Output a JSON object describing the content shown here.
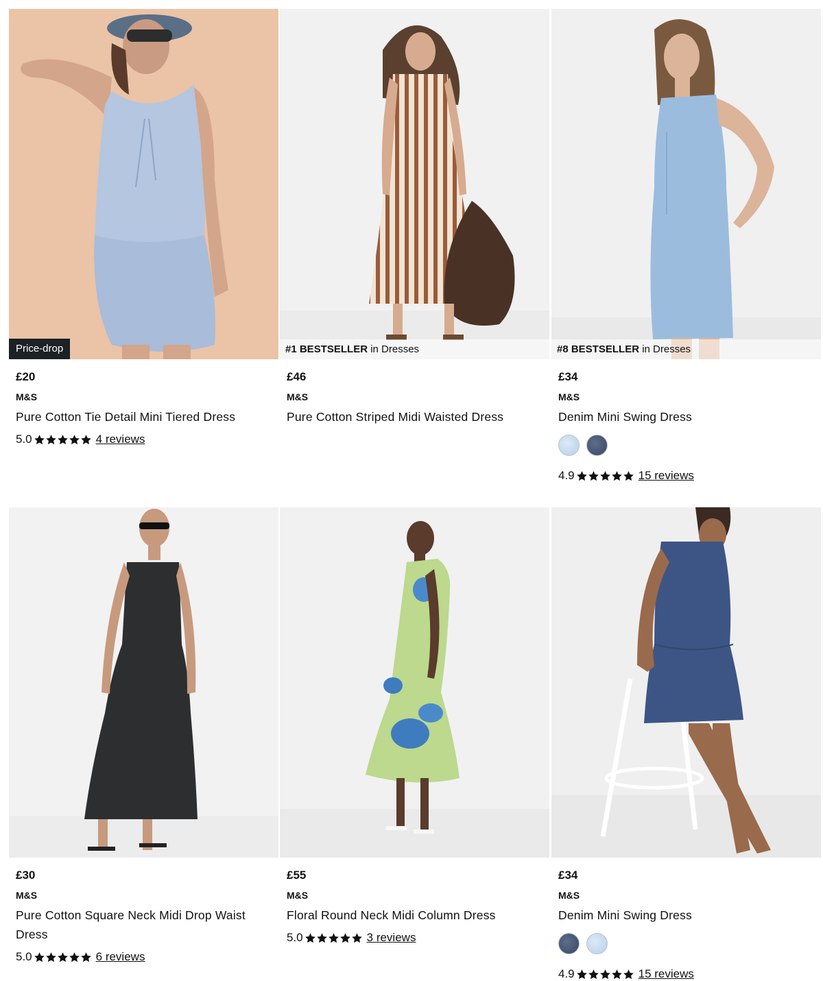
{
  "products": [
    {
      "price": "£20",
      "brand": "M&S",
      "name": "Pure Cotton Tie Detail Mini Tiered Dress",
      "badge": "Price-drop",
      "rating": "5.0",
      "stars": 5,
      "reviews": "4 reviews",
      "image_alt": "Model wearing pale blue sleeveless tiered mini dress against peach wall"
    },
    {
      "price": "£46",
      "brand": "M&S",
      "name": "Pure Cotton Striped Midi Waisted Dress",
      "bestseller_rank": "#1 BESTSELLER",
      "bestseller_suffix": "in Dresses",
      "image_alt": "Model wearing brown and cream striped midi dress holding woven bag"
    },
    {
      "price": "£34",
      "brand": "M&S",
      "name": "Denim Mini Swing Dress",
      "bestseller_rank": "#8 BESTSELLER",
      "bestseller_suffix": "in Dresses",
      "swatches": [
        "light-denim",
        "dark-denim"
      ],
      "rating": "4.9",
      "stars": 5,
      "reviews": "15 reviews",
      "image_alt": "Model wearing light blue denim sleeveless swing dress"
    },
    {
      "price": "£30",
      "brand": "M&S",
      "name": "Pure Cotton Square Neck Midi Drop Waist Dress",
      "rating": "5.0",
      "stars": 5,
      "reviews": "6 reviews",
      "image_alt": "Model wearing black strappy drop waist midi dress"
    },
    {
      "price": "£55",
      "brand": "M&S",
      "name": "Floral Round Neck Midi Column Dress",
      "rating": "5.0",
      "stars": 5,
      "reviews": "3 reviews",
      "image_alt": "Model wearing lime green midi dress with blue floral print"
    },
    {
      "price": "£34",
      "brand": "M&S",
      "name": "Denim Mini Swing Dress",
      "swatches": [
        "dark-denim",
        "light-denim"
      ],
      "rating": "4.9",
      "stars": 5,
      "reviews": "15 reviews",
      "image_alt": "Model wearing dark denim sleeveless swing dress leaning on stool"
    }
  ],
  "colors": {
    "badge_bg": "#1c2126",
    "star": "#111111",
    "light_denim": "#c4dcf2",
    "dark_denim": "#44516e"
  }
}
